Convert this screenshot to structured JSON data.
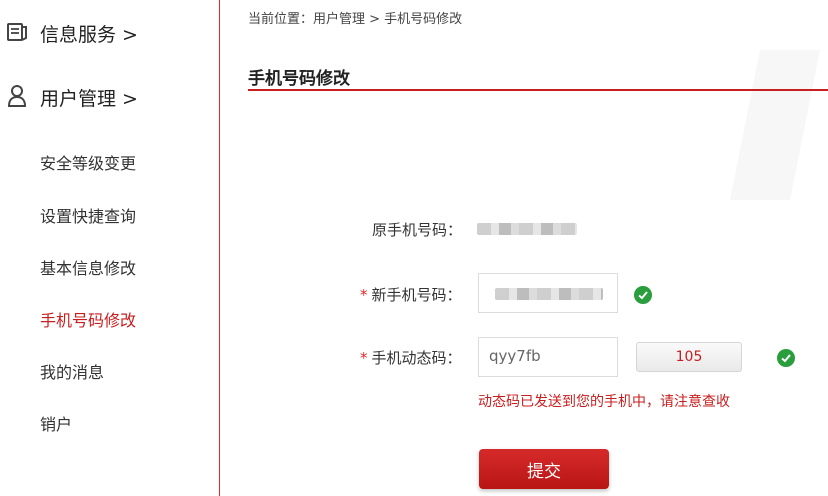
{
  "sidebar": {
    "sections": [
      {
        "label": "信息服务 >",
        "icon": "document-icon"
      },
      {
        "label": "用户管理 >",
        "icon": "user-icon"
      }
    ],
    "items": [
      {
        "label": "安全等级变更"
      },
      {
        "label": "设置快捷查询"
      },
      {
        "label": "基本信息修改"
      },
      {
        "label": "手机号码修改",
        "active": true
      },
      {
        "label": "我的消息"
      },
      {
        "label": "销户"
      }
    ]
  },
  "breadcrumb": "当前位置：用户管理 > 手机号码修改",
  "page_title": "手机号码修改",
  "form": {
    "old_phone_label": "原手机号码：",
    "new_phone_label": "新手机号码：",
    "code_label": "手机动态码：",
    "required_mark": "*",
    "code_value": "qyy7fb",
    "countdown": "105",
    "hint": "动态码已发送到您的手机中，请注意查收",
    "submit_label": "提交"
  },
  "colors": {
    "accent": "#c81e1e",
    "success": "#2a9d3d"
  }
}
